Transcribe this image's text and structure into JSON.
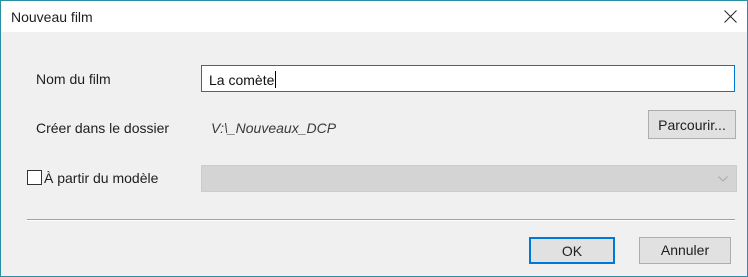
{
  "window": {
    "title": "Nouveau film"
  },
  "form": {
    "film_name_label": "Nom du film",
    "film_name_value": "La comète",
    "folder_label": "Créer dans le dossier",
    "folder_path": "V:\\_Nouveaux_DCP",
    "browse_label": "Parcourir...",
    "template_label": "À partir du modèle",
    "template_checked": false,
    "template_selected": ""
  },
  "buttons": {
    "ok_label": "OK",
    "cancel_label": "Annuler"
  },
  "icons": {
    "close": "close-icon",
    "dropdown": "chevron-down-icon"
  },
  "colors": {
    "window_border": "#2b8fa3",
    "focus_accent": "#0078d7"
  }
}
